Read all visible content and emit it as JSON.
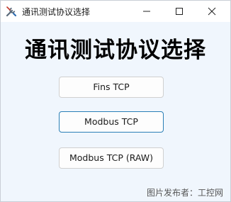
{
  "window": {
    "title": "通讯测试协议选择",
    "icon": "tools-icon"
  },
  "heading": "通讯测试协议选择",
  "buttons": {
    "fins_tcp": "Fins TCP",
    "modbus_tcp": "Modbus TCP",
    "modbus_tcp_raw": "Modbus TCP (RAW)"
  },
  "watermark": "图片发布者：工控网",
  "colors": {
    "client_bg": "#f0f6fd",
    "focus_border": "#2a7fb6"
  }
}
